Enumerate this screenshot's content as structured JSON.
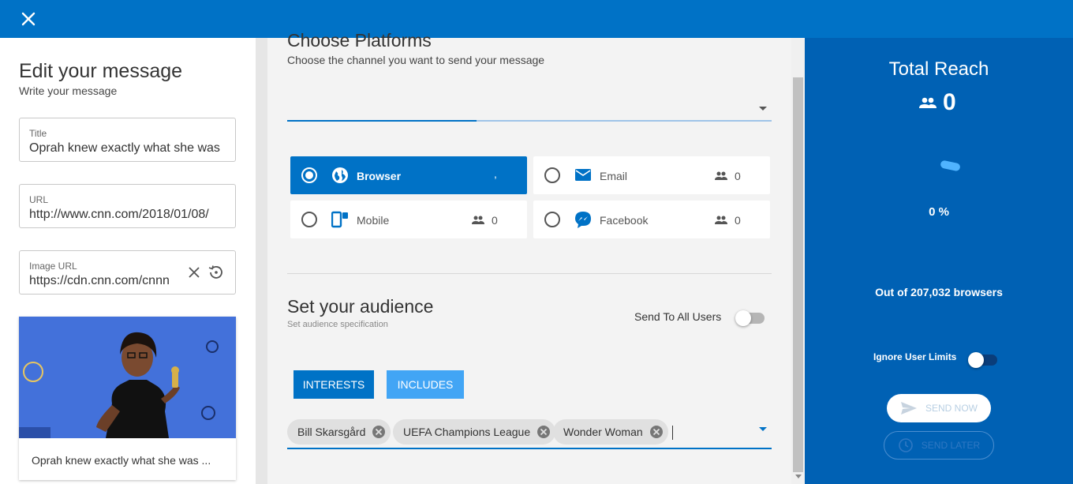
{
  "left": {
    "heading": "Edit your message",
    "subheading": "Write your message",
    "fields": [
      {
        "label": "Title",
        "value": "Oprah knew exactly what she was"
      },
      {
        "label": "URL",
        "value": "http://www.cnn.com/2018/01/08/"
      },
      {
        "label": "Image URL",
        "value": "https://cdn.cnn.com/cnnn"
      }
    ],
    "preview": {
      "caption": "Oprah knew exactly what she was ..."
    }
  },
  "platforms": {
    "title": "Choose Platforms",
    "subtitle": "Choose the channel you want to send your message",
    "tiles": [
      {
        "label": "Browser",
        "icon": "globe-icon",
        "count": ",",
        "selected": true
      },
      {
        "label": "Email",
        "icon": "email-icon",
        "count": "0",
        "selected": false
      },
      {
        "label": "Mobile",
        "icon": "mobile-icon",
        "count": "0",
        "selected": false
      },
      {
        "label": "Facebook",
        "icon": "messenger-icon",
        "count": "0",
        "selected": false
      }
    ]
  },
  "audience": {
    "title": "Set your audience",
    "subtitle": "Set audience specification",
    "send_to_all_label": "Send To All Users",
    "send_to_all": false,
    "interests_label": "INTERESTS",
    "includes_label": "INCLUDES",
    "chips": [
      "Bill Skarsgård",
      "UEFA Champions League",
      "Wonder Woman"
    ]
  },
  "summary": {
    "title": "Total Reach",
    "reach": "0",
    "percent": "0 %",
    "out_of": "Out of 207,032 browsers",
    "ignore_label": "Ignore User Limits",
    "ignore_limits": false,
    "send_now": "SEND NOW",
    "send_later": "SEND LATER"
  },
  "colors": {
    "primary": "#0072c6",
    "panel": "#0061b4",
    "includes": "#42a5f5"
  }
}
